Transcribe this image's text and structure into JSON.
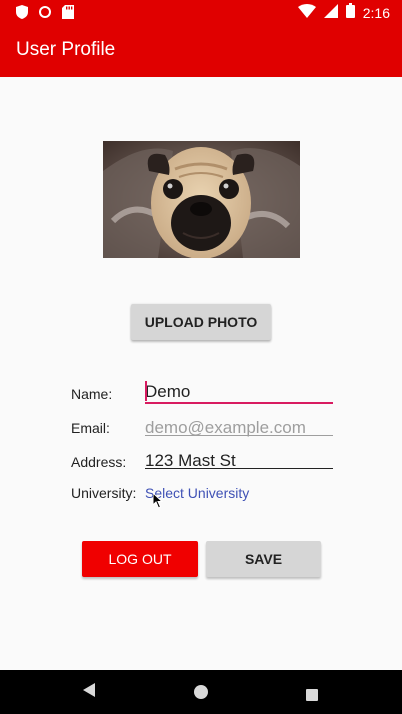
{
  "status_bar": {
    "time": "2:16",
    "icons": [
      "shield-icon",
      "record-icon",
      "sd-card-icon",
      "wifi-icon",
      "signal-icon",
      "battery-icon"
    ]
  },
  "app_bar": {
    "title": "User Profile",
    "color": "#e00000"
  },
  "profile": {
    "upload_label": "UPLOAD PHOTO",
    "fields": {
      "name_label": "Name:",
      "name_value": "Demo",
      "email_label": "Email:",
      "email_placeholder": "demo@example.com",
      "address_label": "Address:",
      "address_value": "123 Mast St",
      "university_label": "University:",
      "university_value": "Select University"
    }
  },
  "actions": {
    "logout_label": "LOG OUT",
    "save_label": "SAVE",
    "logout_color": "#f00000",
    "save_color": "#d6d6d6"
  },
  "nav_bar": {
    "icons": [
      "back-icon",
      "home-icon",
      "recent-apps-icon"
    ]
  }
}
